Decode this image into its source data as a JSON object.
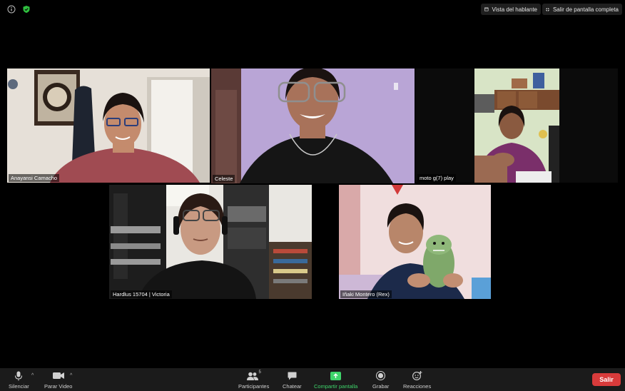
{
  "topbar": {
    "info_icon": "info-icon",
    "security_icon": "shield-icon",
    "security_color": "#2fbf3f",
    "speaker_view_label": "Vista del hablante",
    "exit_fullscreen_label": "Salir de pantalla completa"
  },
  "participants": [
    {
      "name": "Anayansi Camacho"
    },
    {
      "name": "Celeste"
    },
    {
      "name": "moto g(7) play"
    },
    {
      "name": "Hardlus 15704 | Victoria"
    },
    {
      "name": "Iñaki Montero (Rex)"
    }
  ],
  "active_speaker_color": "#d8d36a",
  "toolbar": {
    "mute_label": "Silenciar",
    "video_label": "Parar Video",
    "participants_label": "Participantes",
    "participants_count": "5",
    "chat_label": "Chatear",
    "share_label": "Compartir pantalla",
    "share_color": "#3fd56b",
    "record_label": "Grabar",
    "reactions_label": "Reacciones",
    "leave_label": "Salir",
    "leave_color": "#d83b3b"
  }
}
